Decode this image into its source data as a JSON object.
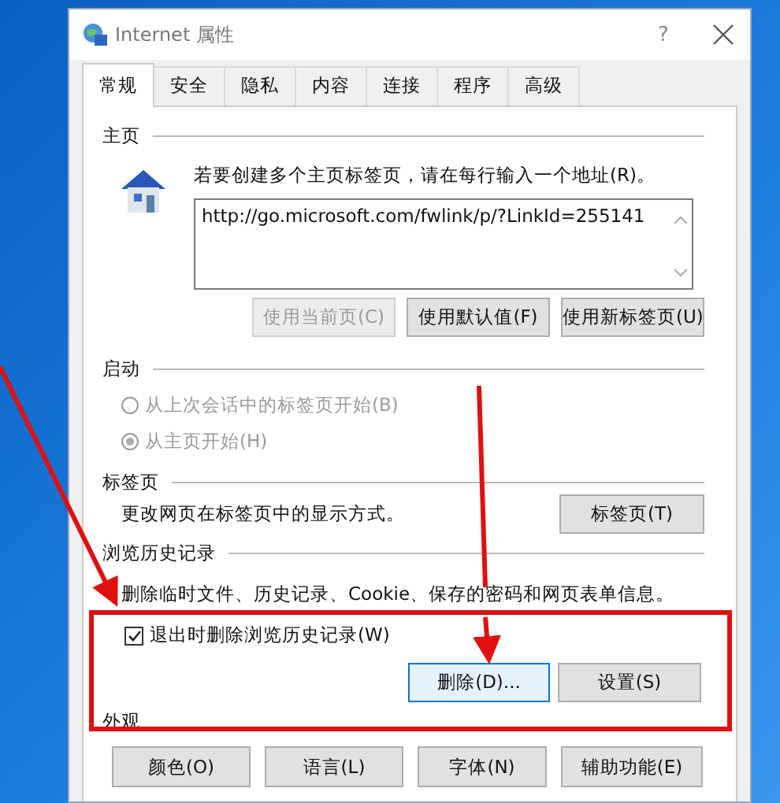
{
  "window": {
    "title": "Internet 属性",
    "help": "?"
  },
  "tabs": [
    {
      "label": "常规",
      "selected": true
    },
    {
      "label": "安全",
      "selected": false
    },
    {
      "label": "隐私",
      "selected": false
    },
    {
      "label": "内容",
      "selected": false
    },
    {
      "label": "连接",
      "selected": false
    },
    {
      "label": "程序",
      "selected": false
    },
    {
      "label": "高级",
      "selected": false
    }
  ],
  "homepage": {
    "heading": "主页",
    "instruction": "若要创建多个主页标签页，请在每行输入一个地址(R)。",
    "urls": "http://go.microsoft.com/fwlink/p/?LinkId=255141",
    "buttons": [
      {
        "label": "使用当前页(C)",
        "disabled": true
      },
      {
        "label": "使用默认值(F)",
        "disabled": false
      },
      {
        "label": "使用新标签页(U)",
        "disabled": false
      }
    ]
  },
  "startup": {
    "heading": "启动",
    "options": [
      {
        "label": "从上次会话中的标签页开始(B)",
        "selected": false,
        "disabled": true
      },
      {
        "label": "从主页开始(H)",
        "selected": true,
        "disabled": true
      }
    ]
  },
  "tab_settings": {
    "heading": "标签页",
    "description": "更改网页在标签页中的显示方式。",
    "button": "标签页(T)"
  },
  "history": {
    "heading": "浏览历史记录",
    "description": "删除临时文件、历史记录、Cookie、保存的密码和网页表单信息。",
    "delete_on_exit": {
      "label": "退出时删除浏览历史记录(W)",
      "checked": true
    },
    "buttons": [
      {
        "label": "删除(D)...",
        "focused": true
      },
      {
        "label": "设置(S)",
        "focused": false
      }
    ]
  },
  "appearance": {
    "heading": "外观",
    "buttons": [
      "颜色(O)",
      "语言(L)",
      "字体(N)",
      "辅助功能(E)"
    ]
  }
}
